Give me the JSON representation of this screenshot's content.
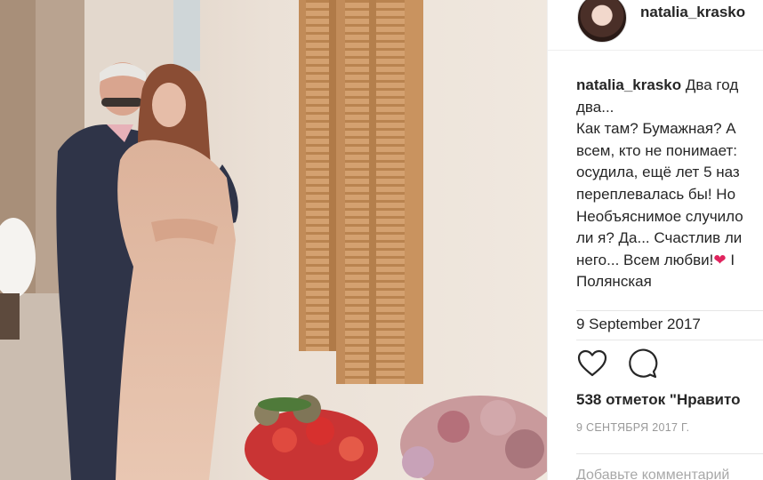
{
  "post": {
    "username": "natalia_krasko",
    "caption_lines": [
      "Два год",
      "два...",
      "Как там? Бумажная? А",
      "всем, кто не понимает:",
      "осудила, ещё лет 5 наз",
      "переплевалась бы! Но",
      "Необъяснимое случило",
      "ли я? Да... Счастлив ли",
      "него... Всем любви!",
      "Полянская"
    ],
    "heart_emoji": "❤",
    "caption_tail": " I",
    "date": "9 September 2017",
    "likes": "538 отметок \"Нравито",
    "date_upper": "9 СЕНТЯБРЯ 2017 Г.",
    "comment_placeholder": "Добавьте комментарий"
  },
  "icons": {
    "like": "heart-outline-icon",
    "comment": "speech-bubble-icon"
  },
  "colors": {
    "text": "#262626",
    "muted": "#999999",
    "heart": "#e0245e",
    "border": "#efefef"
  }
}
